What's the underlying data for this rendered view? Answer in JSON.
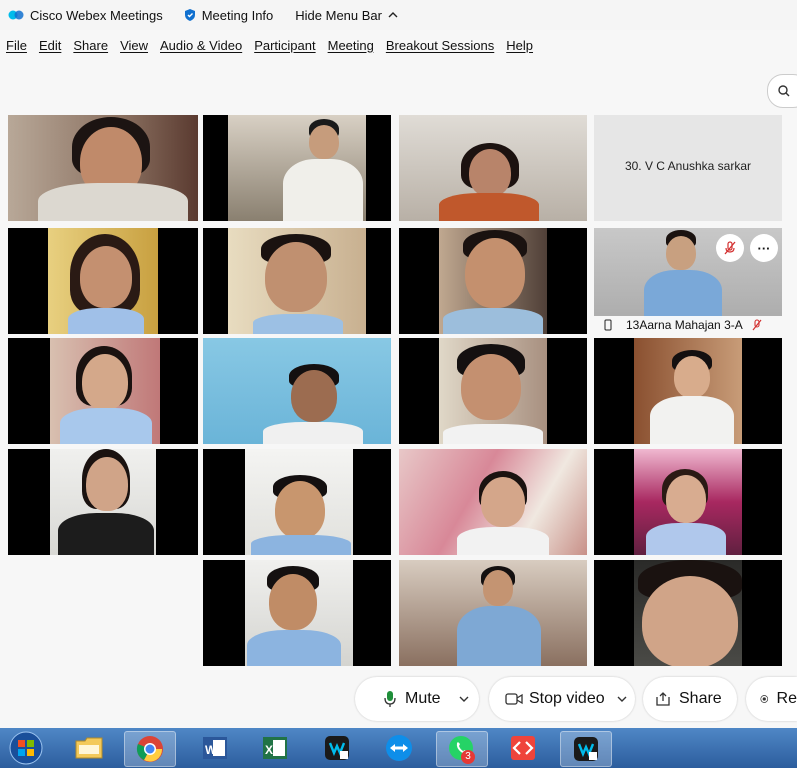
{
  "titlebar": {
    "app_name": "Cisco Webex Meetings",
    "meeting_info": "Meeting Info",
    "hide_menu": "Hide Menu Bar",
    "hide_menu_chevron": "^"
  },
  "menu": [
    "File",
    "Edit",
    "Share",
    "View",
    "Audio & Video",
    "Participant",
    "Meeting",
    "Breakout Sessions",
    "Help"
  ],
  "participants": {
    "anushka_tile_name": "30. V C Anushka sarkar",
    "aarna_tile_name": "13Aarna Mahajan 3-A",
    "more_button": "···"
  },
  "controls": {
    "mute_label": "Mute",
    "stop_video_label": "Stop video",
    "share_label": "Share",
    "record_label": "Re"
  },
  "taskbar": {
    "whatsapp_badge": "3"
  },
  "colors": {
    "mute_icon": "#1f8f3a",
    "muted_red": "#d32f2f",
    "taskbar": "#3b6fb0",
    "webex_blue": "#1170cf"
  }
}
